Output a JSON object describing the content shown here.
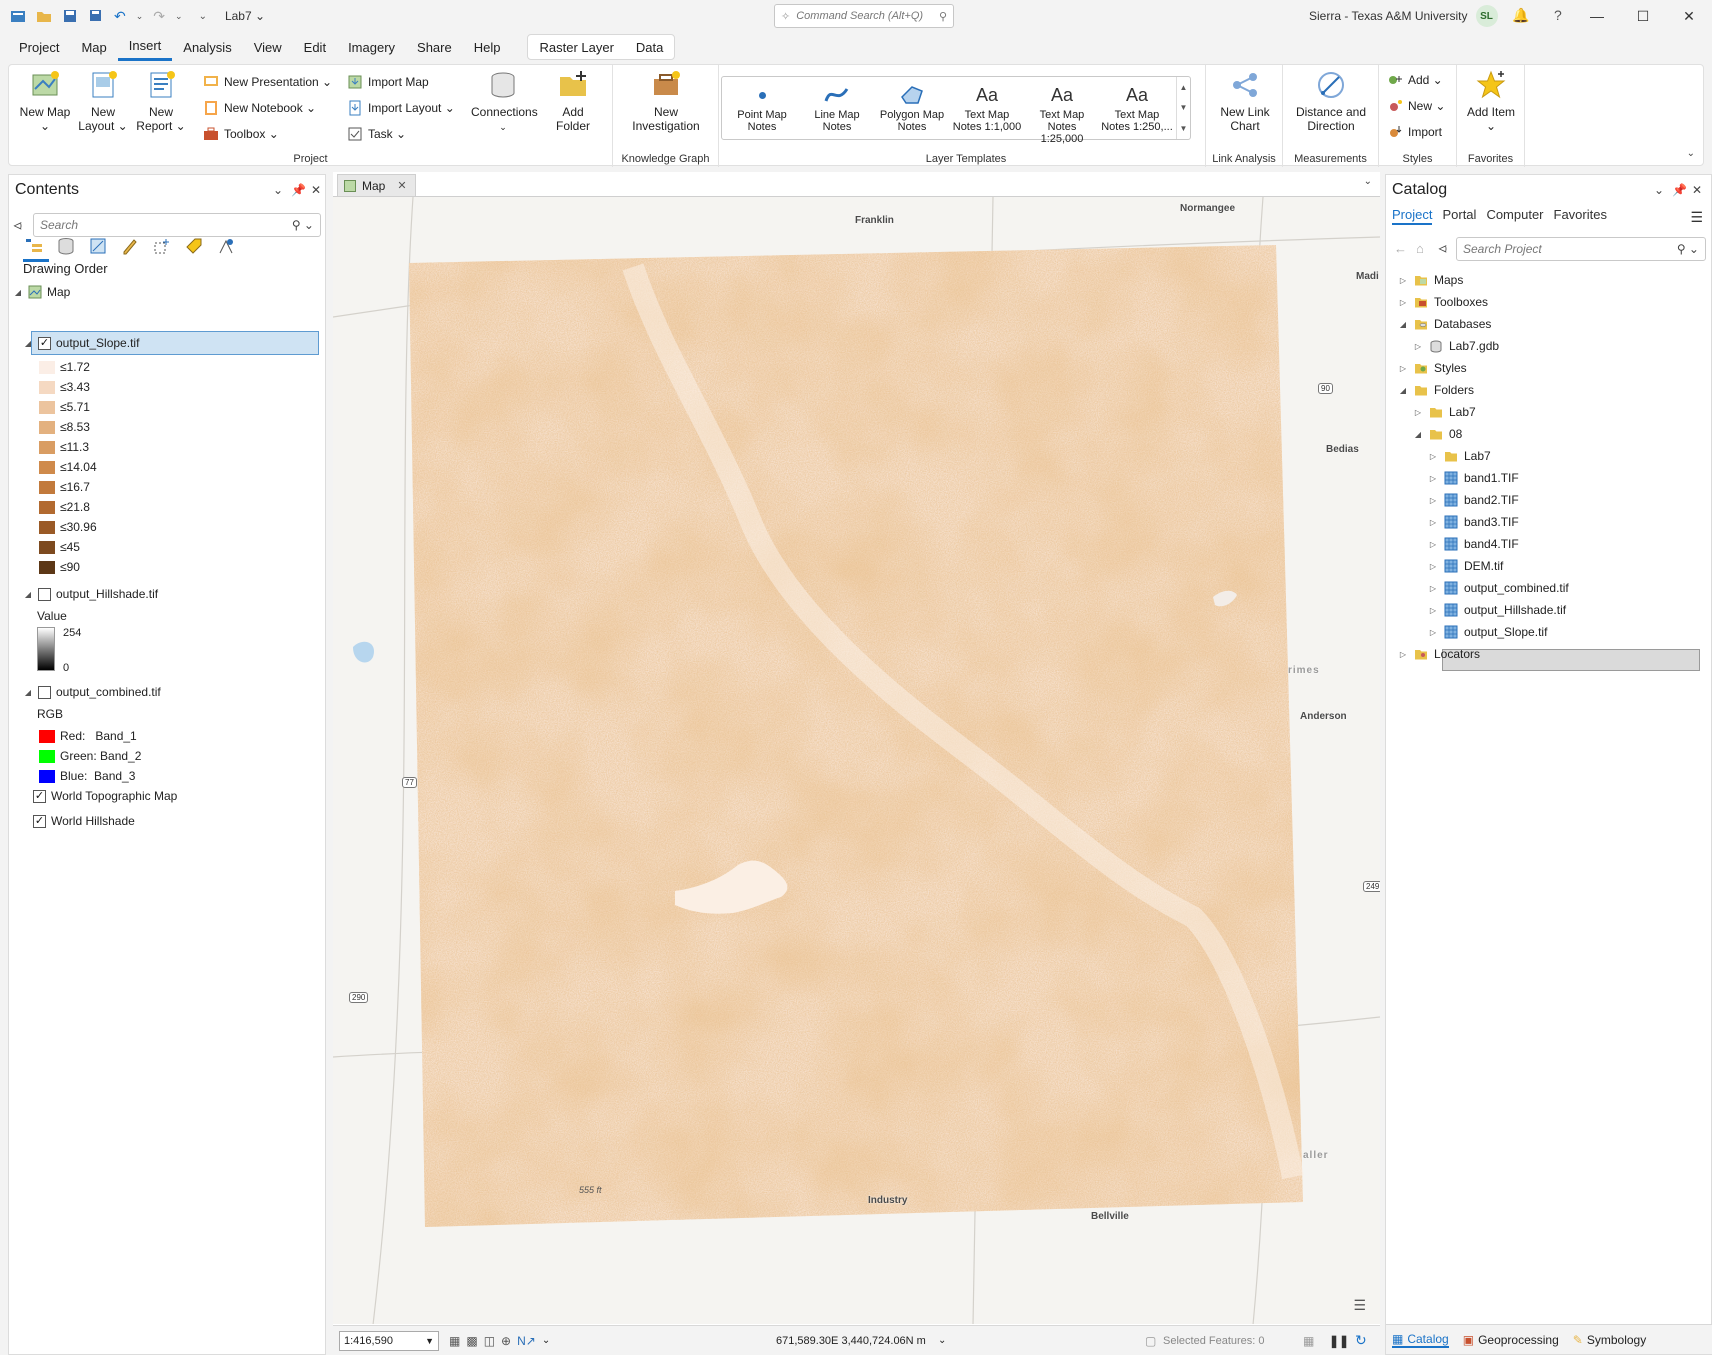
{
  "titlebar": {
    "project_title": "Lab7 ⌄",
    "command_search_placeholder": "Command Search (Alt+Q)",
    "user_name": "Sierra - Texas A&M University",
    "user_initials": "SL"
  },
  "menu": {
    "tabs": [
      "Project",
      "Map",
      "Insert",
      "Analysis",
      "View",
      "Edit",
      "Imagery",
      "Share",
      "Help"
    ],
    "contextual_tabs": [
      "Raster Layer",
      "Data"
    ]
  },
  "ribbon": {
    "project_group": {
      "label": "Project",
      "new_map": "New Map ⌄",
      "new_layout": "New Layout ⌄",
      "new_report": "New Report ⌄",
      "new_presentation": "New Presentation ⌄",
      "new_notebook": "New Notebook ⌄",
      "toolbox": "Toolbox ⌄",
      "import_map": "Import Map",
      "import_layout": "Import Layout ⌄",
      "task": "Task ⌄",
      "connections": "Connections",
      "add_folder": "Add Folder"
    },
    "knowledge_graph": {
      "label": "Knowledge Graph",
      "new_investigation": "New Investigation"
    },
    "layer_templates": {
      "label": "Layer Templates",
      "items": [
        "Point Map Notes",
        "Line Map Notes",
        "Polygon Map Notes",
        "Text Map Notes 1:1,000",
        "Text Map Notes 1:25,000",
        "Text Map Notes 1:250,..."
      ]
    },
    "link_analysis": {
      "label": "Link Analysis",
      "new_link_chart": "New Link Chart"
    },
    "measurements": {
      "label": "Measurements",
      "distance_direction": "Distance and Direction"
    },
    "styles": {
      "label": "Styles",
      "add": "Add ⌄",
      "new": "New ⌄",
      "import": "Import"
    },
    "favorites": {
      "label": "Favorites",
      "add_item": "Add Item ⌄"
    }
  },
  "contents": {
    "title": "Contents",
    "search_placeholder": "Search",
    "drawing_order": "Drawing Order",
    "map_label": "Map",
    "slope_layer": "output_Slope.tif",
    "slope_classes": [
      "≤1.72",
      "≤3.43",
      "≤5.71",
      "≤8.53",
      "≤11.3",
      "≤14.04",
      "≤16.7",
      "≤21.8",
      "≤30.96",
      "≤45",
      "≤90"
    ],
    "slope_colors": [
      "#fbeee6",
      "#f5d9c2",
      "#ecc49e",
      "#e3b17f",
      "#d99d63",
      "#cf8a4b",
      "#c27a3c",
      "#b26a30",
      "#9a5a26",
      "#7d4a1f",
      "#5c3716"
    ],
    "hillshade_layer": "output_Hillshade.tif",
    "hillshade_value_label": "Value",
    "hillshade_high": "254",
    "hillshade_low": "0",
    "combined_layer": "output_combined.tif",
    "rgb_label": "RGB",
    "rgb_bands": [
      {
        "label": "Red:   Band_1",
        "color": "#ff0000"
      },
      {
        "label": "Green: Band_2",
        "color": "#00ff00"
      },
      {
        "label": "Blue:  Band_3",
        "color": "#0000ff"
      }
    ],
    "basemap_topo": "World Topographic Map",
    "basemap_hillshade": "World Hillshade"
  },
  "map": {
    "tab_label": "Map",
    "place_labels": [
      "Franklin",
      "Normangee",
      "Madi",
      "Bedias",
      "Anderson",
      "Industry",
      "Bellville",
      "rimes",
      "aller"
    ],
    "route_labels": [
      "90",
      "77",
      "249",
      "290"
    ],
    "elevation_label": "555 ft",
    "scale": "1:416,590",
    "coordinates": "671,589.30E 3,440,724.06N m",
    "selected_features": "Selected Features: 0"
  },
  "catalog": {
    "title": "Catalog",
    "tabs": [
      "Project",
      "Portal",
      "Computer",
      "Favorites"
    ],
    "search_placeholder": "Search Project",
    "items": [
      "Maps",
      "Toolboxes",
      "Databases",
      "Lab7.gdb",
      "Styles",
      "Folders",
      "Lab7",
      "08",
      "Lab7",
      "band1.TIF",
      "band2.TIF",
      "band3.TIF",
      "band4.TIF",
      "DEM.tif",
      "output_combined.tif",
      "output_Hillshade.tif",
      "output_Slope.tif",
      "Locators"
    ],
    "bottom_tabs": [
      "Catalog",
      "Geoprocessing",
      "Symbology"
    ]
  }
}
